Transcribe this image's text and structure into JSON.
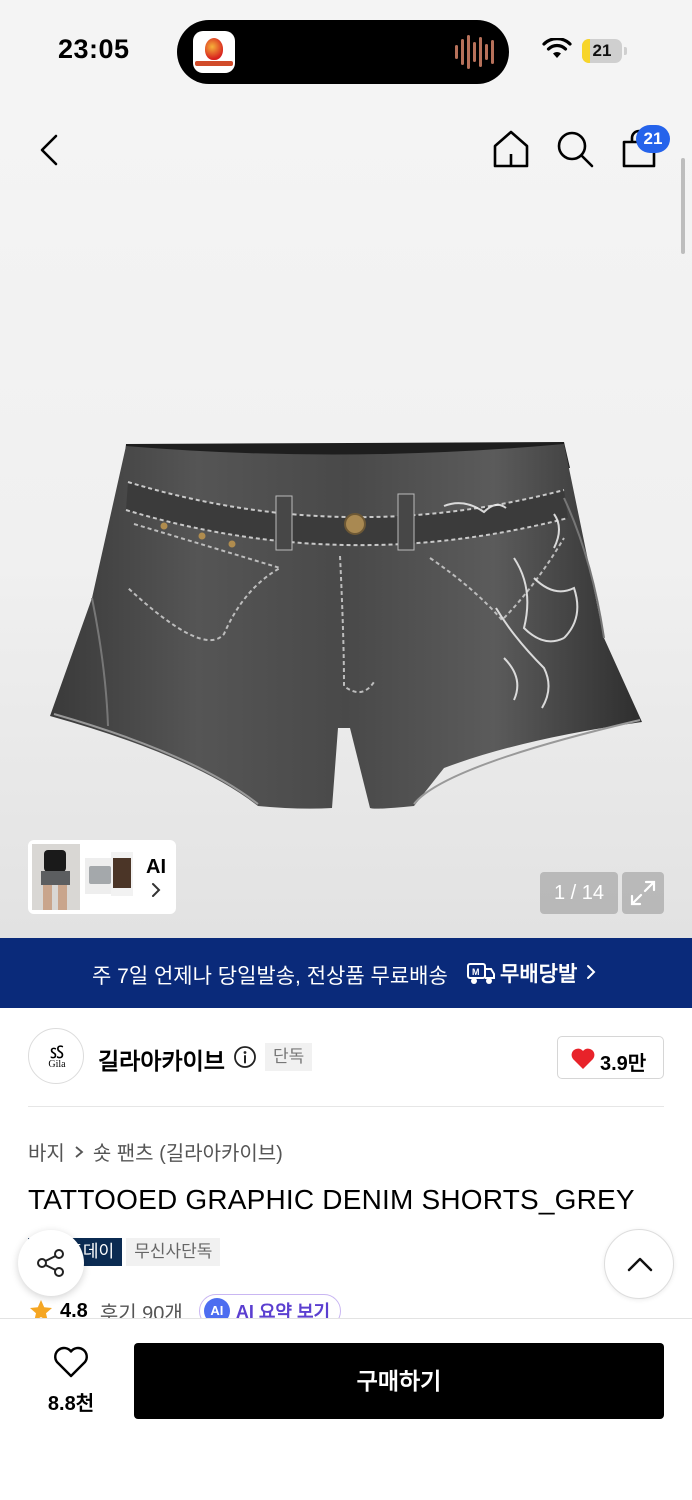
{
  "status_bar": {
    "time": "23:05",
    "battery_level": "21",
    "battery_fraction": 0.21,
    "island_app": "music-app-icon"
  },
  "header": {
    "icons": [
      "back-icon",
      "home-icon",
      "search-icon",
      "shopping-bag-icon"
    ],
    "cart_count": "21"
  },
  "gallery": {
    "ai_label": "AI",
    "counter": "1 / 14"
  },
  "banner": {
    "text": "주 7일 언제나 당일발송, 전상품 무료배송",
    "brand": "무배당발"
  },
  "brand": {
    "name": "길라아카이브",
    "badge": "단독",
    "like_count": "3.9만"
  },
  "product": {
    "breadcrumb": [
      "바지",
      "숏 팬츠 (길라아카이브)"
    ],
    "title": "TATTOOED GRAPHIC DENIM SHORTS_GREY",
    "tags": [
      "브랜드데이",
      "무신사단독"
    ],
    "rating": "4.8",
    "reviews": "후기 90개",
    "ai_summary": "AI 요약 보기",
    "ai_summary_badge": "AI"
  },
  "bottom": {
    "wish_count": "8.8천",
    "buy_label": "구매하기"
  },
  "colors": {
    "banner_bg": "#0a2a7a",
    "badge_blue": "#2563eb",
    "heart_red": "#e8232a",
    "star": "#f5a623"
  }
}
